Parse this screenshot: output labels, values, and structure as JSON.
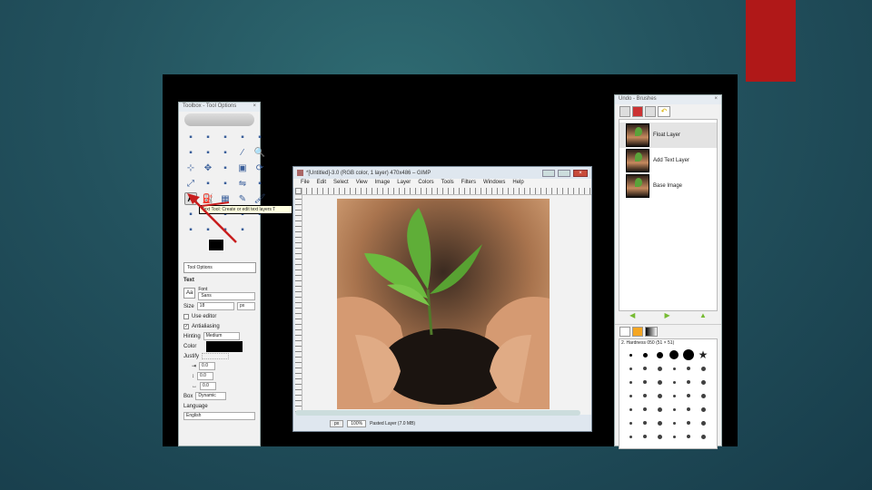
{
  "colors": {
    "accent": "#b01818",
    "background": "#23525e"
  },
  "toolbox": {
    "title": "Toolbox - Tool Options",
    "tooltip": "Text Tool: Create or edit text layers  T",
    "tools": [
      "rect-select",
      "ellipse-select",
      "free-select",
      "fuzzy-select",
      "select-by-color",
      "scissors",
      "foreground-select",
      "paths",
      "color-picker",
      "zoom",
      "measure",
      "move",
      "align",
      "crop",
      "rotate",
      "scale",
      "shear",
      "perspective",
      "flip",
      "cage",
      "text",
      "bucket-fill",
      "blend",
      "pencil",
      "paintbrush",
      "eraser",
      "airbrush",
      "ink",
      "clone",
      "heal",
      "perspective-clone",
      "blur",
      "smudge",
      "dodge-burn"
    ],
    "fg_color": "#000000",
    "options": {
      "tab": "Tool Options",
      "section": "Text",
      "font_label": "Font",
      "font_value": "Sans",
      "size_label": "Size",
      "size_value": "18",
      "size_unit": "px",
      "use_editor": "Use editor",
      "antialiasing": "Antialiasing",
      "hinting_label": "Hinting",
      "hinting_value": "Medium",
      "color_label": "Color",
      "justify_label": "Justify",
      "indent": "0.0",
      "line_spacing": "0.0",
      "letter_spacing": "0.0",
      "box_label": "Box",
      "box_value": "Dynamic",
      "language_label": "Language",
      "language_value": "English"
    }
  },
  "image_window": {
    "title": "*[Untitled]-3.0 (RGB color, 1 layer) 470x486 – GIMP",
    "menu": [
      "File",
      "Edit",
      "Select",
      "View",
      "Image",
      "Layer",
      "Colors",
      "Tools",
      "Filters",
      "Windows",
      "Help"
    ],
    "unit": "px",
    "zoom": "100%",
    "status": "Pasted Layer (7.0 MB)"
  },
  "dock": {
    "title": "Undo - Brushes",
    "history": [
      {
        "label": "Float Layer"
      },
      {
        "label": "Add Text Layer"
      },
      {
        "label": "Base Image"
      }
    ],
    "brush_filter": "2. Hardness 050 (51 × 51)"
  }
}
